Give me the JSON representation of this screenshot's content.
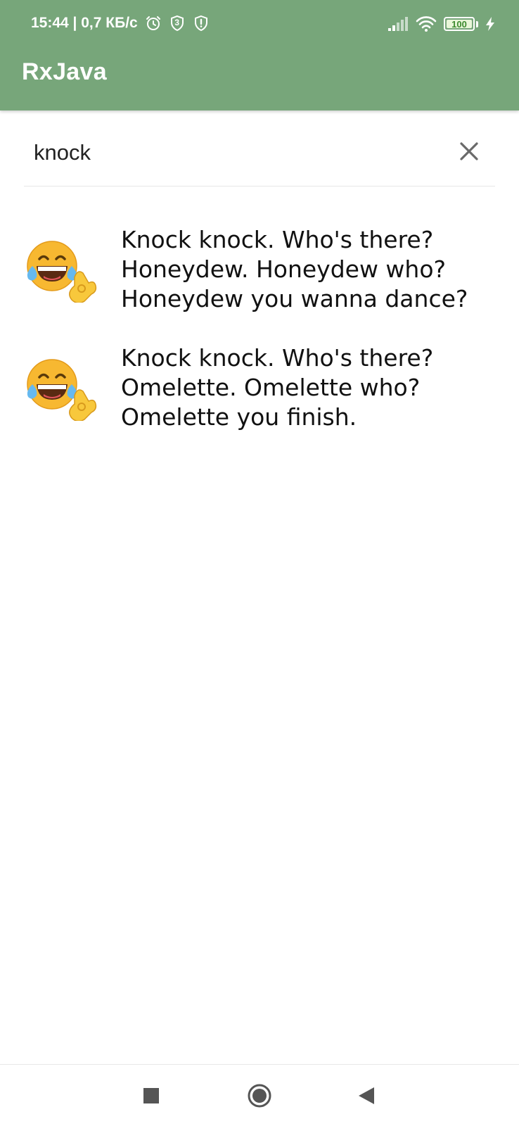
{
  "status_bar": {
    "time_and_speed": "15:44 | 0,7 КБ/с",
    "badge_number": "3",
    "battery_level": "100",
    "icons": [
      "alarm-icon",
      "shield-badge-icon",
      "alert-shield-icon",
      "signal-icon",
      "wifi-icon",
      "battery-icon",
      "charging-icon"
    ]
  },
  "app_bar": {
    "title": "RxJava",
    "color": "#77a67a"
  },
  "search": {
    "value": "knock",
    "clear_icon": "close-icon"
  },
  "results": [
    {
      "emoji": "laughing-ok-emoji",
      "text": "Knock knock. Who's there?\nHoneydew. Honeydew who?\nHoneydew you wanna dance?"
    },
    {
      "emoji": "laughing-ok-emoji",
      "text": "Knock knock. Who's there?\nOmelette. Omelette who?\nOmelette you finish."
    }
  ],
  "nav_bar": {
    "buttons": [
      "recents-square-icon",
      "home-circle-icon",
      "back-triangle-icon"
    ]
  }
}
